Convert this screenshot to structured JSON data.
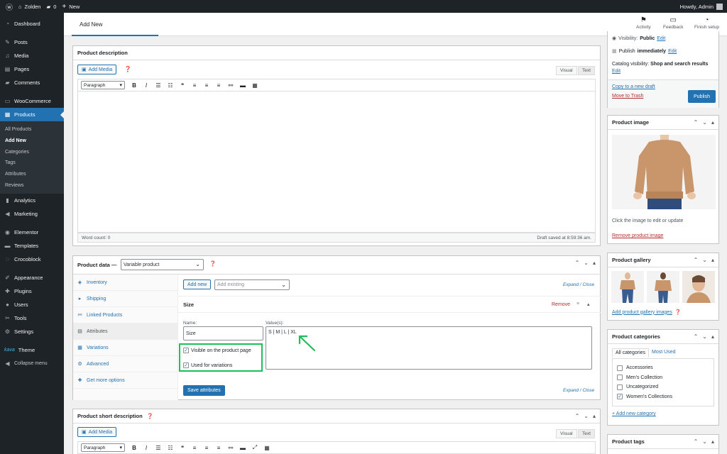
{
  "adminbar": {
    "site_name": "Zolden",
    "comments_count": "0",
    "new_label": "New",
    "howdy": "Howdy, Admin"
  },
  "sidebar": {
    "items": [
      {
        "label": "Dashboard",
        "icon": "dashboard-icon"
      },
      {
        "label": "Posts",
        "icon": "pin-icon"
      },
      {
        "label": "Media",
        "icon": "media-icon"
      },
      {
        "label": "Pages",
        "icon": "page-icon"
      },
      {
        "label": "Comments",
        "icon": "comment-icon"
      },
      {
        "label": "WooCommerce",
        "icon": "woo-icon"
      },
      {
        "label": "Products",
        "icon": "products-icon"
      },
      {
        "label": "Analytics",
        "icon": "bar-chart-icon"
      },
      {
        "label": "Marketing",
        "icon": "megaphone-icon"
      },
      {
        "label": "Elementor",
        "icon": "elementor-icon"
      },
      {
        "label": "Templates",
        "icon": "folder-icon"
      },
      {
        "label": "Crocoblock",
        "icon": "crocoblock-icon"
      },
      {
        "label": "Appearance",
        "icon": "brush-icon"
      },
      {
        "label": "Plugins",
        "icon": "plug-icon"
      },
      {
        "label": "Users",
        "icon": "user-icon"
      },
      {
        "label": "Tools",
        "icon": "wrench-icon"
      },
      {
        "label": "Settings",
        "icon": "settings-icon"
      },
      {
        "label": "Theme",
        "icon": "kava-icon",
        "prefix": "kava"
      },
      {
        "label": "Collapse menu",
        "icon": "collapse-icon"
      }
    ],
    "submenu": [
      "All Products",
      "Add New",
      "Categories",
      "Tags",
      "Attributes",
      "Reviews"
    ]
  },
  "header": {
    "title": "Add New",
    "actions": [
      "Activity",
      "Feedback",
      "Finish setup"
    ]
  },
  "description": {
    "title": "Product description",
    "add_media": "Add Media",
    "tab_visual": "Visual",
    "tab_text": "Text",
    "paragraph": "Paragraph",
    "word_count": "Word count: 0",
    "draft_saved": "Draft saved at 8:59:36 am."
  },
  "product_data": {
    "title": "Product data —",
    "type": "Variable product",
    "tabs": [
      "Inventory",
      "Shipping",
      "Linked Products",
      "Attributes",
      "Variations",
      "Advanced",
      "Get more options"
    ],
    "add_new": "Add new",
    "add_existing_placeholder": "Add existing",
    "expand_close": "Expand / Close",
    "attribute_name": "Size",
    "remove": "Remove",
    "name_label": "Name:",
    "name_value": "Size",
    "values_label": "Value(s):",
    "values_value": "S | M | L | XL",
    "visible_label": "Visible on the product page",
    "variations_label": "Used for variations",
    "save_attributes": "Save attributes"
  },
  "short_description": {
    "title": "Product short description",
    "add_media": "Add Media",
    "tab_visual": "Visual",
    "tab_text": "Text",
    "paragraph": "Paragraph"
  },
  "publish": {
    "visibility_label": "Visibility:",
    "visibility_value": "Public",
    "edit": "Edit",
    "publish_label": "Publish",
    "publish_value": "immediately",
    "catalog_label": "Catalog visibility:",
    "catalog_value": "Shop and search results",
    "copy_draft": "Copy to a new draft",
    "move_trash": "Move to Trash",
    "publish_button": "Publish"
  },
  "product_image": {
    "title": "Product image",
    "hint": "Click the image to edit or update",
    "remove": "Remove product image"
  },
  "gallery": {
    "title": "Product gallery",
    "add": "Add product gallery images"
  },
  "categories": {
    "title": "Product categories",
    "tab_all": "All categories",
    "tab_most": "Most Used",
    "items": [
      {
        "label": "Accessories",
        "checked": false
      },
      {
        "label": "Men's Collection",
        "checked": false
      },
      {
        "label": "Uncategorized",
        "checked": false
      },
      {
        "label": "Women's Collections",
        "checked": true
      }
    ],
    "add_new": "+ Add new category"
  },
  "tags": {
    "title": "Product tags"
  },
  "colors": {
    "wp_blue": "#2271b1",
    "admin_dark": "#1d2327",
    "highlight_green": "#1fbe5a",
    "remove_red": "#b32d2e"
  }
}
